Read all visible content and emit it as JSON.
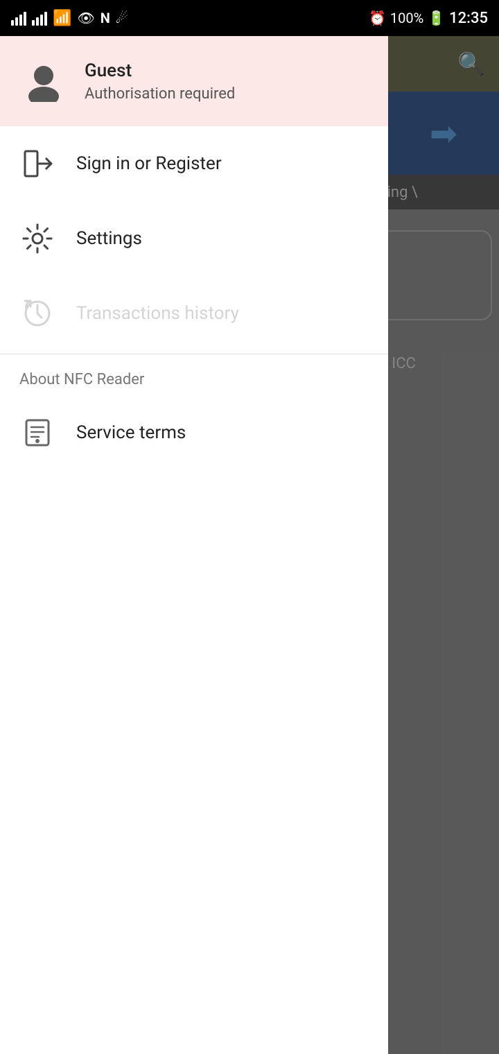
{
  "status_bar": {
    "battery": "100%",
    "time": "12:35"
  },
  "user": {
    "name": "Guest",
    "subtitle": "Authorisation required"
  },
  "menu": {
    "sign_in_label": "Sign in or Register",
    "settings_label": "Settings",
    "transactions_label": "Transactions history",
    "section_label": "About NFC Reader",
    "service_terms_label": "Service terms"
  },
  "bg": {
    "pending_text": "pending \\",
    "icc_text": "ee the ICC"
  }
}
